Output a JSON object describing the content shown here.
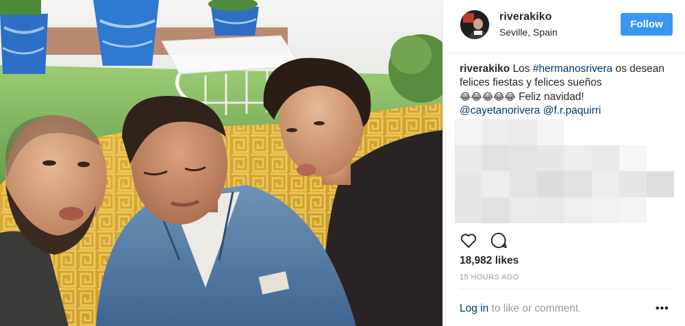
{
  "post": {
    "username": "riverakiko",
    "location": "Seville, Spain",
    "follow_label": "Follow"
  },
  "caption": {
    "username": "riverakiko",
    "text_before": "Los ",
    "hashtag": "#hermanosrivera",
    "text_after": " os desean felices fiestas y felices sueños",
    "emojis": "😂😂😂😂😂",
    "text_end": " Feliz navidad!",
    "mention_1": "@cayetanorivera",
    "mention_2": "@f.r.paquirri"
  },
  "stats": {
    "likes": "18,982 likes",
    "time": "15 HOURS AGO"
  },
  "footer": {
    "login_label": "Log in",
    "rest": " to like or comment.",
    "more_label": "•••"
  },
  "icons": {
    "like": "heart-icon",
    "comment": "comment-icon",
    "more": "more-options-icon"
  },
  "colors": {
    "accent": "#3897f0",
    "link": "#003569",
    "muted": "#999999"
  }
}
